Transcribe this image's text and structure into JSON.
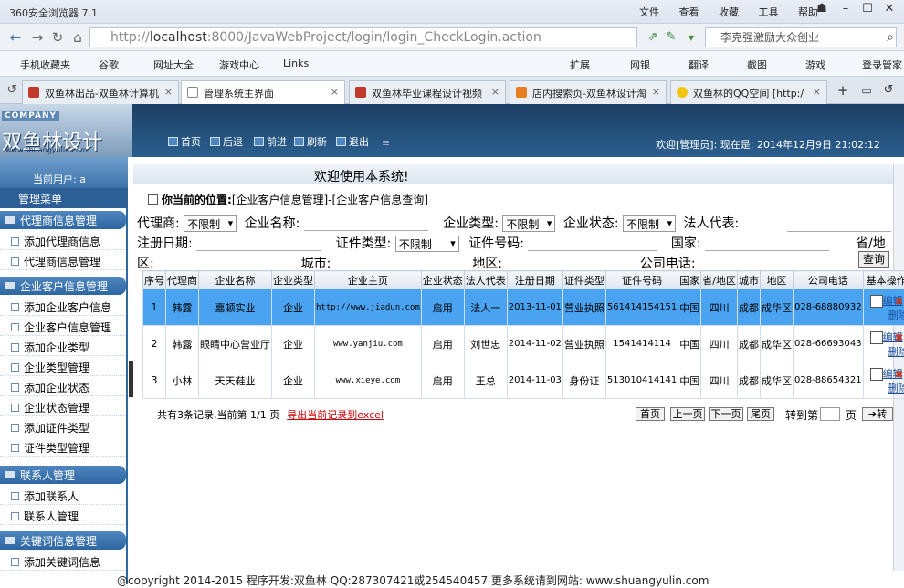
{
  "browser": {
    "title": "360安全浏览器 7.1",
    "menus": [
      "文件",
      "查看",
      "收藏",
      "工具",
      "帮助"
    ],
    "url_prefix": "http://",
    "url_host": "localhost",
    "url_rest": ":8000/JavaWebProject/login/login_CheckLogin.action",
    "search_text": "李克强激励大众创业",
    "favorites": [
      "手机收藏夹",
      "谷歌",
      "网址大全",
      "游戏中心",
      "Links"
    ],
    "toolbar_right": [
      "扩展",
      "网银",
      "翻译",
      "截图",
      "游戏",
      "登录管家"
    ],
    "tabs": [
      {
        "label": "双鱼林出品-双鱼林计算机",
        "active": false
      },
      {
        "label": "管理系统主界面",
        "active": true
      },
      {
        "label": "双鱼林毕业课程设计视频",
        "active": false
      },
      {
        "label": "店内搜索页-双鱼林设计淘",
        "active": false
      },
      {
        "label": "双鱼林的QQ空间 [http:/",
        "active": false
      }
    ]
  },
  "header": {
    "company": "COMPANY",
    "logo_text": "双鱼林设计",
    "logo_url": "www.shuangyulin.com",
    "nav": [
      "首页",
      "后退",
      "前进",
      "刷新",
      "退出"
    ],
    "welcome": "欢迎[管理员]:  现在是: 2014年12月9日 21:02:12"
  },
  "sidebar": {
    "current_user": "当前用户: a",
    "main_menu": "管理菜单",
    "groups": [
      {
        "title": "代理商信息管理",
        "items": [
          "添加代理商信息",
          "代理商信息管理"
        ]
      },
      {
        "title": "企业客户信息管理",
        "items": [
          "添加企业客户信息",
          "企业客户信息管理",
          "添加企业类型",
          "企业类型管理",
          "添加企业状态",
          "企业状态管理",
          "添加证件类型",
          "证件类型管理"
        ]
      },
      {
        "title": "联系人管理",
        "items": [
          "添加联系人",
          "联系人管理"
        ]
      },
      {
        "title": "关键词信息管理",
        "items": [
          "添加关键词信息"
        ]
      }
    ]
  },
  "main": {
    "welcome_bar": "欢迎使用本系统!",
    "location_label": "你当前的位置:",
    "location_path": "[企业客户信息管理]-[企业客户信息查询]",
    "filters": {
      "agent_label": "代理商:",
      "agent_value": "不限制",
      "company_name_label": "企业名称:",
      "company_type_label": "企业类型:",
      "company_type_value": "不限制",
      "company_state_label": "企业状态:",
      "company_state_value": "不限制",
      "legal_rep_label": "法人代表:",
      "reg_date_label": "注册日期:",
      "cert_type_label": "证件类型:",
      "cert_type_value": "不限制",
      "cert_no_label": "证件号码:",
      "country_label": "国家:",
      "province_label": "省/地",
      "district_label": "区:",
      "city_label": "城市:",
      "area_label": "地区:",
      "phone_label": "公司电话:",
      "query_button": "查询"
    },
    "table": {
      "headers": [
        "序号",
        "代理商",
        "企业名称",
        "企业类型",
        "企业主页",
        "企业状态",
        "法人代表",
        "注册日期",
        "证件类型",
        "证件号码",
        "国家",
        "省/地区",
        "城市",
        "地区",
        "公司电话",
        "基本操作"
      ],
      "rows": [
        [
          "1",
          "韩露",
          "嘉顿实业",
          "企业",
          "http://www.jiadun.com",
          "启用",
          "法人一",
          "2013-11-01",
          "营业执照",
          "561414154151",
          "中国",
          "四川",
          "成都",
          "成华区",
          "028-68880932"
        ],
        [
          "2",
          "韩露",
          "眼睛中心营业厅",
          "企业",
          "www.yanjiu.com",
          "启用",
          "刘世忠",
          "2014-11-02",
          "营业执照",
          "1541414114",
          "中国",
          "四川",
          "成都",
          "成华区",
          "028-66693043"
        ],
        [
          "3",
          "小林",
          "天天鞋业",
          "企业",
          "www.xieye.com",
          "启用",
          "王总",
          "2014-11-03",
          "身份证",
          "513010414141",
          "中国",
          "四川",
          "成都",
          "成华区",
          "028-88654321"
        ]
      ],
      "edit_label": "编辑",
      "delete_label": "删除"
    },
    "pager": {
      "summary": "共有3条记录,当前第 1/1 页",
      "export_link": "导出当前记录到excel",
      "first": "首页",
      "prev": "上一页",
      "next": "下一页",
      "last": "尾页",
      "goto_label": "转到第",
      "page_unit": "页",
      "go_button": "转"
    }
  },
  "footer": {
    "text": "@copyright 2014-2015  程序开发:双鱼林  QQ:287307421或254540457  更多系统请到网站: www.shuangyulin.com"
  },
  "colors": {
    "header_bg": "#1c3f63",
    "sidebar_group": "#2d66a2",
    "highlight_row": "#49a3f0"
  }
}
